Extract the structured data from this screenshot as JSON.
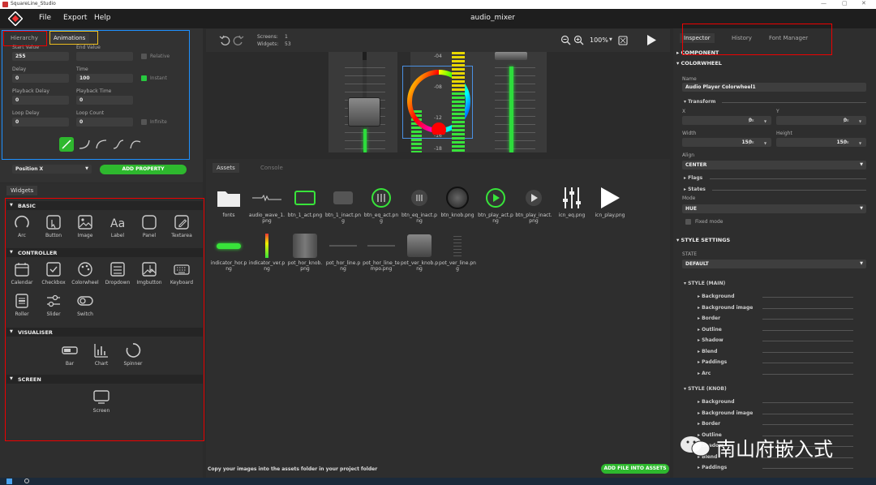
{
  "app": {
    "title": "SquareLine_Studio",
    "project": "audio_mixer"
  },
  "menu": [
    "File",
    "Export",
    "Help"
  ],
  "left_tabs": {
    "hierarchy": "Hierarchy",
    "animations": "Animations"
  },
  "anim": {
    "start_value_label": "Start Value",
    "start_value": "255",
    "end_value_label": "End Value",
    "relative": "Relative",
    "delay_label": "Delay",
    "delay": "0",
    "time_label": "Time",
    "time": "100",
    "instant": "Instant",
    "playback_delay_label": "Playback Delay",
    "playback_delay": "0",
    "playback_time_label": "Playback Time",
    "playback_time": "0",
    "loop_delay_label": "Loop Delay",
    "loop_delay": "0",
    "loop_count_label": "Loop Count",
    "loop_count": "0",
    "infinite": "Infinite",
    "property_select": "Position X",
    "add_property": "ADD PROPERTY"
  },
  "widgets_tab": "Widgets",
  "widget_sections": {
    "basic": "BASIC",
    "controller": "CONTROLLER",
    "visualiser": "VISUALISER",
    "screen": "SCREEN"
  },
  "widgets": {
    "arc": "Arc",
    "button": "Button",
    "image": "Image",
    "label": "Label",
    "panel": "Panel",
    "textarea": "Textarea",
    "calendar": "Calendar",
    "checkbox": "Checkbox",
    "colorwheel": "Colorwheel",
    "dropdown": "Dropdown",
    "imgbutton": "Imgbutton",
    "keyboard": "Keyboard",
    "roller": "Roller",
    "slider": "Slider",
    "switch": "Switch",
    "bar": "Bar",
    "chart": "Chart",
    "spinner": "Spinner",
    "screen": "Screen"
  },
  "toolbar": {
    "screens_label": "Screens:",
    "screens": "1",
    "widgets_label": "Widgets:",
    "widgets": "53",
    "zoom": "100%"
  },
  "canvas_scale": [
    "-04",
    "-08",
    "-12",
    "-16",
    "-18"
  ],
  "assets_tabs": {
    "assets": "Assets",
    "console": "Console"
  },
  "assets": [
    "fonts",
    "audio_wave_1.png",
    "btn_1_act.png",
    "btn_1_inact.png",
    "btn_eq_act.png",
    "btn_eq_inact.png",
    "btn_knob.png",
    "btn_play_act.png",
    "btn_play_inact.png",
    "icn_eq.png",
    "icn_play.png",
    "indicator_hor.png",
    "indicator_ver.png",
    "pot_hor_knob.png",
    "pot_hor_line.png",
    "pot_hor_line_tempo.png",
    "pot_ver_knob.png",
    "pot_ver_line.png"
  ],
  "assets_hint": "Copy your images into the assets folder in your project folder",
  "add_file": "ADD FILE INTO ASSETS",
  "right_tabs": {
    "inspector": "Inspector",
    "history": "History",
    "font_manager": "Font Manager"
  },
  "inspector": {
    "component": "COMPONENT",
    "colorwheel": "COLORWHEEL",
    "name_label": "Name",
    "name": "Audio Player Colorwheel1",
    "transform": "Transform",
    "x_label": "X",
    "x": "0",
    "y_label": "Y",
    "y": "0",
    "width_label": "Width",
    "width": "150",
    "height_label": "Height",
    "height": "150",
    "unit": "px",
    "align_label": "Align",
    "align": "CENTER",
    "flags": "Flags",
    "states": "States",
    "mode_label": "Mode",
    "mode": "HUE",
    "fixed_mode": "Fixed mode",
    "style_settings": "STYLE SETTINGS",
    "state_label": "STATE",
    "state": "DEFAULT",
    "style_main": "STYLE (MAIN)",
    "main_items": [
      "Background",
      "Background image",
      "Border",
      "Outline",
      "Shadow",
      "Blend",
      "Paddings",
      "Arc"
    ],
    "style_knob": "STYLE (KNOB)",
    "knob_items": [
      "Background",
      "Background image",
      "Border",
      "Outline",
      "Shadow",
      "Blend",
      "Paddings"
    ]
  },
  "watermark": "南山府嵌入式",
  "colors": {
    "accent_green": "#2eb82e",
    "annot_red": "#e00000",
    "annot_blue": "#1e90ff",
    "annot_yellow": "#f0c020"
  }
}
